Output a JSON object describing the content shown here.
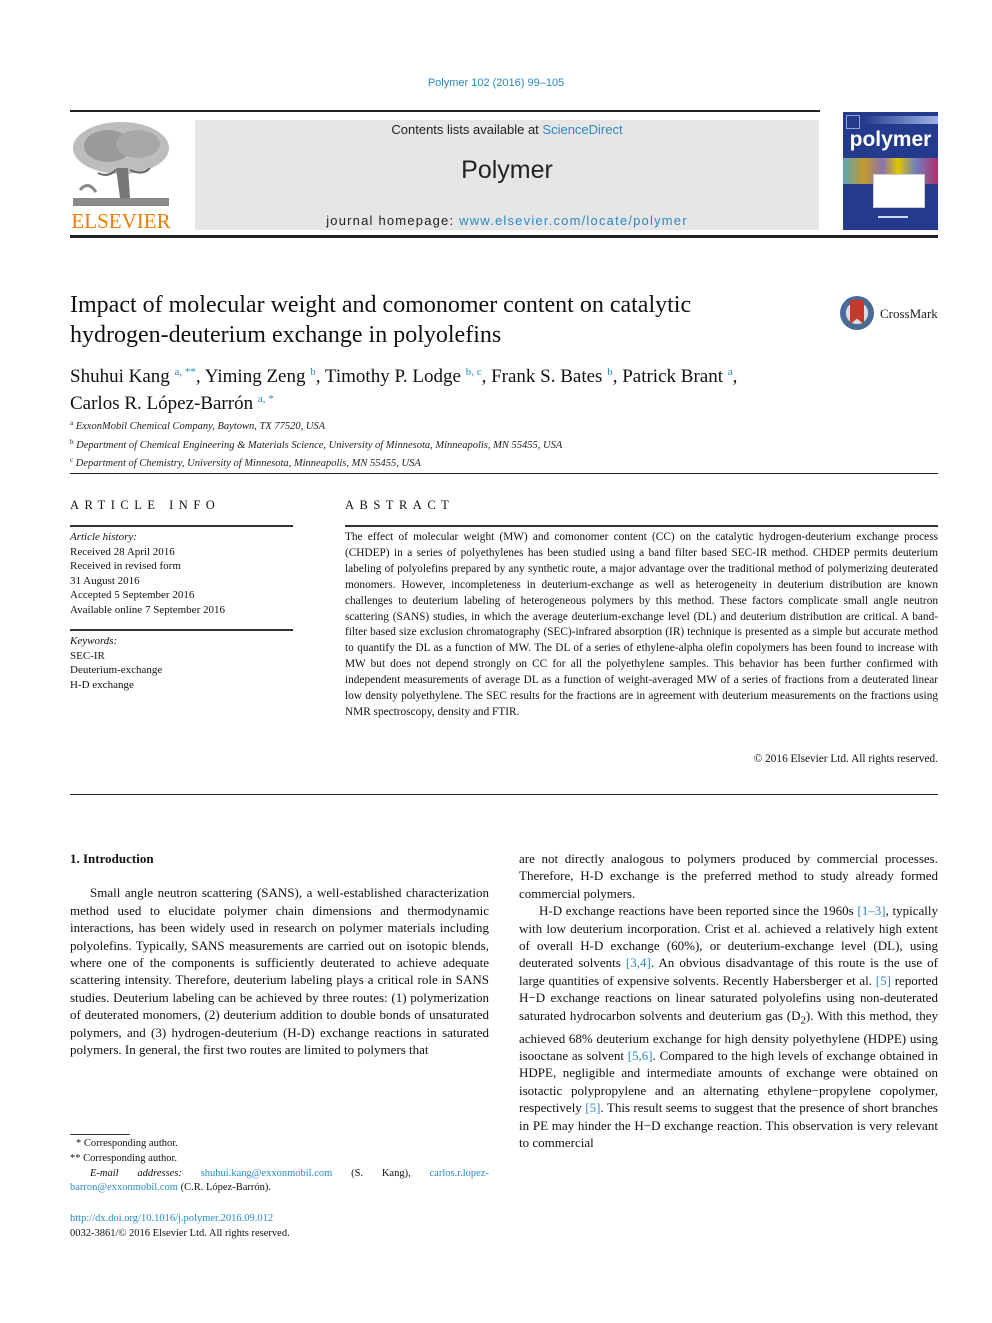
{
  "header": {
    "citation": "Polymer 102 (2016) 99–105",
    "contents_prefix": "Contents lists available at ",
    "contents_link": "ScienceDirect",
    "journal_name": "Polymer",
    "homepage_prefix": "journal homepage: ",
    "homepage_link": "www.elsevier.com/locate/polymer",
    "publisher_logo_text": "ELSEVIER",
    "cover_title": "polymer",
    "colors": {
      "link": "#2a8ac4",
      "elsevier_orange": "#f07c00",
      "cover_blue": "#243a8c",
      "masthead_gray": "#e6e6e6"
    }
  },
  "article": {
    "title_line1": "Impact of molecular weight and comonomer content on catalytic",
    "title_line2": "hydrogen-deuterium exchange in polyolefins",
    "crossmark_label": "CrossMark",
    "authors": [
      {
        "name": "Shuhui Kang",
        "sup": "a, **",
        "sep": ", "
      },
      {
        "name": "Yiming Zeng",
        "sup": "b",
        "sep": ", "
      },
      {
        "name": "Timothy P. Lodge",
        "sup": "b, c",
        "sep": ", "
      },
      {
        "name": "Frank S. Bates",
        "sup": "b",
        "sep": ", "
      },
      {
        "name": "Patrick Brant",
        "sup": "a",
        "sep": ","
      },
      {
        "name": "Carlos R. López-Barrón",
        "sup": "a, *",
        "sep": ""
      }
    ],
    "affiliations": [
      {
        "key": "a",
        "text": "ExxonMobil Chemical Company, Baytown, TX 77520, USA"
      },
      {
        "key": "b",
        "text": "Department of Chemical Engineering & Materials Science, University of Minnesota, Minneapolis, MN 55455, USA"
      },
      {
        "key": "c",
        "text": "Department of Chemistry, University of Minnesota, Minneapolis, MN 55455, USA"
      }
    ]
  },
  "article_info": {
    "heading": "ARTICLE INFO",
    "history_label": "Article history:",
    "history": [
      "Received 28 April 2016",
      "Received in revised form",
      "31 August 2016",
      "Accepted 5 September 2016",
      "Available online 7 September 2016"
    ],
    "keywords_label": "Keywords:",
    "keywords": [
      "SEC-IR",
      "Deuterium-exchange",
      "H-D exchange"
    ]
  },
  "abstract": {
    "heading": "ABSTRACT",
    "text": "The effect of molecular weight (MW) and comonomer content (CC) on the catalytic hydrogen-deuterium exchange process (CHDEP) in a series of polyethylenes has been studied using a band filter based SEC-IR method. CHDEP permits deuterium labeling of polyolefins prepared by any synthetic route, a major advantage over the traditional method of polymerizing deuterated monomers. However, incompleteness in deuterium-exchange as well as heterogeneity in deuterium distribution are known challenges to deuterium labeling of heterogeneous polymers by this method. These factors complicate small angle neutron scattering (SANS) studies, in which the average deuterium-exchange level (DL) and deuterium distribution are critical. A band-filter based size exclusion chromatography (SEC)-infrared absorption (IR) technique is presented as a simple but accurate method to quantify the DL as a function of MW. The DL of a series of ethylene-alpha olefin copolymers has been found to increase with MW but does not depend strongly on CC for all the polyethylene samples. This behavior has been further confirmed with independent measurements of average DL as a function of weight-averaged MW of a series of fractions from a deuterated linear low density polyethylene. The SEC results for the fractions are in agreement with deuterium measurements on the fractions using NMR spectroscopy, density and FTIR.",
    "copyright": "© 2016 Elsevier Ltd. All rights reserved."
  },
  "body": {
    "section_heading": "1.  Introduction",
    "left_paragraph": "Small angle neutron scattering (SANS), a well-established characterization method used to elucidate polymer chain dimensions and thermodynamic interactions, has been widely used in research on polymer materials including polyolefins. Typically, SANS measurements are carried out on isotopic blends, where one of the components is sufficiently deuterated to achieve adequate scattering intensity. Therefore, deuterium labeling plays a critical role in SANS studies. Deuterium labeling can be achieved by three routes: (1) polymerization of deuterated monomers, (2) deuterium addition to double bonds of unsaturated polymers, and (3) hydrogen-deuterium (H-D) exchange reactions in saturated polymers. In general, the first two routes are limited to polymers that",
    "right_continuation": "are not directly analogous to polymers produced by commercial processes. Therefore, H-D exchange is the preferred method to study already formed commercial polymers.",
    "right_p2": {
      "t1": "H-D exchange reactions have been reported since the 1960s ",
      "ref1": "[1–3]",
      "t2": ", typically with low deuterium incorporation. Crist et al. achieved a relatively high extent of overall H-D exchange (60%), or deuterium-exchange level (DL), using deuterated solvents ",
      "ref2": "[3,4]",
      "t3": ". An obvious disadvantage of this route is the use of large quantities of expensive solvents. Recently Habersberger et al. ",
      "ref3": "[5]",
      "t4": " reported H−D exchange reactions on linear saturated polyolefins using non-deuterated saturated hydrocarbon solvents and deuterium gas (D",
      "sub": "2",
      "t5": "). With this method, they achieved 68% deuterium exchange for high density polyethylene (HDPE) using isooctane as solvent ",
      "ref4": "[5,6]",
      "t6": ". Compared to the high levels of exchange obtained in HDPE, negligible and intermediate amounts of exchange were obtained on isotactic polypropylene and an alternating ethylene−propylene copolymer, respectively ",
      "ref5": "[5]",
      "t7": ". This result seems to suggest that the presence of short branches in PE may hinder the H−D exchange reaction. This observation is very relevant to commercial"
    }
  },
  "footnotes": {
    "star1": "*  Corresponding author.",
    "star2": "**  Corresponding author.",
    "email_label": "E-mail addresses: ",
    "email1": "shuhui.kang@exxonmobil.com",
    "email1_owner": " (S. Kang), ",
    "email2": "carlos.r.lopez-barron@exxonmobil.com",
    "email2_owner": " (C.R. López-Barrón).",
    "doi": "http://dx.doi.org/10.1016/j.polymer.2016.09.012",
    "issn_copyright": "0032-3861/© 2016 Elsevier Ltd. All rights reserved."
  }
}
